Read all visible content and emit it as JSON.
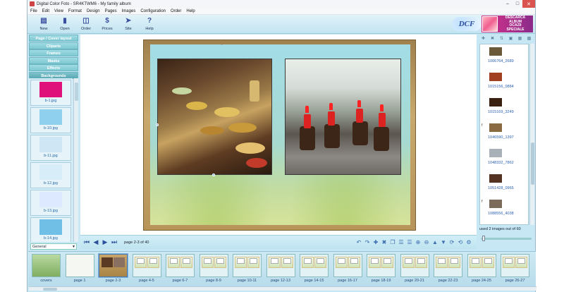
{
  "window": {
    "title": "Digital Color Foto - SR4KTWM6 - My family album"
  },
  "menu": [
    "File",
    "Edit",
    "View",
    "Format",
    "Design",
    "Pages",
    "Images",
    "Configuration",
    "Order",
    "Help"
  ],
  "toolbar": {
    "buttons": [
      {
        "label": "New",
        "icon": "new-icon"
      },
      {
        "label": "Open",
        "icon": "open-icon"
      },
      {
        "label": "Order",
        "icon": "cart-icon"
      },
      {
        "label": "Prices",
        "icon": "dollar-icon"
      },
      {
        "label": "Site",
        "icon": "site-icon"
      },
      {
        "label": "Help",
        "icon": "help-icon"
      }
    ],
    "promo": {
      "logo": "DCF",
      "line1": "DESCARCĂ",
      "line2": "ALBUM",
      "line3": "OCAZII",
      "line4": "SPECIALE"
    }
  },
  "left_panel": {
    "categories": [
      {
        "label": "Page / Cover layout"
      },
      {
        "label": "Cliparts"
      },
      {
        "label": "Frames"
      },
      {
        "label": "Masks"
      },
      {
        "label": "Effects"
      },
      {
        "label": "Backgrounds",
        "active": true
      }
    ],
    "thumbs": [
      {
        "caption": "b-1.jpg",
        "color": "#e0107a"
      },
      {
        "caption": "b-10.jpg",
        "color": "#8fd0ee"
      },
      {
        "caption": "b-11.jpg",
        "color": "#cfe6f4"
      },
      {
        "caption": "b-12.jpg",
        "color": "#d7edf7"
      },
      {
        "caption": "b-13.jpg",
        "color": "#dde9ff"
      },
      {
        "caption": "b-14.jpg",
        "color": "#6fbfe6"
      }
    ],
    "select": "General"
  },
  "workspace": {
    "page_label": "page 2-3 of 40"
  },
  "right_panel": {
    "images": [
      {
        "caption": "1006764_2689",
        "flag": "",
        "color": "#6b5a3a"
      },
      {
        "caption": "1015156_0884",
        "flag": "",
        "color": "#a04020"
      },
      {
        "caption": "1015169_3249",
        "flag": "",
        "color": "#3a2010"
      },
      {
        "caption": "1046590_1397",
        "flag": "f",
        "color": "#8a6a40"
      },
      {
        "caption": "1048332_7862",
        "flag": "",
        "color": "#aab0b8"
      },
      {
        "caption": "1051428_0965",
        "flag": "",
        "color": "#553322"
      },
      {
        "caption": "1088556_4038",
        "flag": "f",
        "color": "#7a6b5a"
      }
    ],
    "status": "used 2 images out of 60"
  },
  "strip": {
    "pages": [
      {
        "caption": "covers"
      },
      {
        "caption": "page 1"
      },
      {
        "caption": "page 2-3",
        "selected": true
      },
      {
        "caption": "page 4-5"
      },
      {
        "caption": "page 6-7"
      },
      {
        "caption": "page 8-9"
      },
      {
        "caption": "page 10-11"
      },
      {
        "caption": "page 12-13"
      },
      {
        "caption": "page 14-15"
      },
      {
        "caption": "page 16-17"
      },
      {
        "caption": "page 18-19"
      },
      {
        "caption": "page 20-21"
      },
      {
        "caption": "page 22-23"
      },
      {
        "caption": "page 24-25"
      },
      {
        "caption": "page 26-27"
      }
    ]
  }
}
